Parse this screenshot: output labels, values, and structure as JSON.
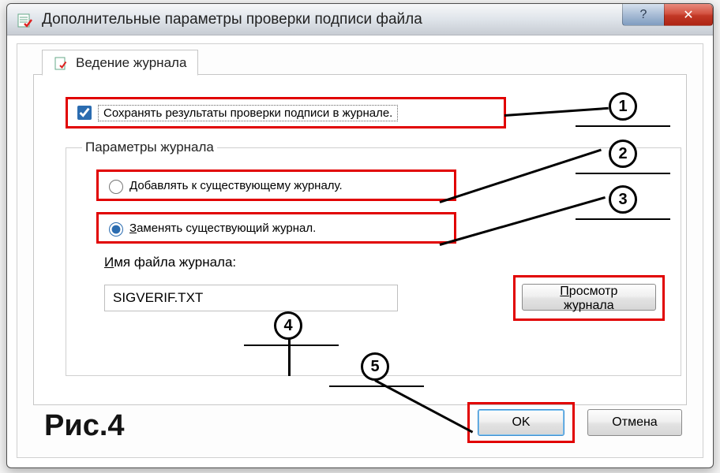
{
  "window": {
    "title": "Дополнительные параметры проверки подписи файла"
  },
  "tab": {
    "label": "Ведение журнала"
  },
  "checkbox": {
    "label": "Сохранять результаты проверки подписи в журнале."
  },
  "groupbox": {
    "legend": "Параметры журнала"
  },
  "radio": {
    "append": "Добавлять к существующему журналу.",
    "append_ul": "Д",
    "replace": "аменять существующий журнал.",
    "replace_ul": "З"
  },
  "file": {
    "label": "мя файла журнала:",
    "label_ul": "И",
    "value": "SIGVERIF.TXT"
  },
  "buttons": {
    "view": "росмотр журнала",
    "view_ul": "П",
    "ok": "OK",
    "cancel": "Отмена"
  },
  "figure": {
    "label": "Рис.4"
  },
  "annotations": {
    "n1": "1",
    "n2": "2",
    "n3": "3",
    "n4": "4",
    "n5": "5"
  }
}
